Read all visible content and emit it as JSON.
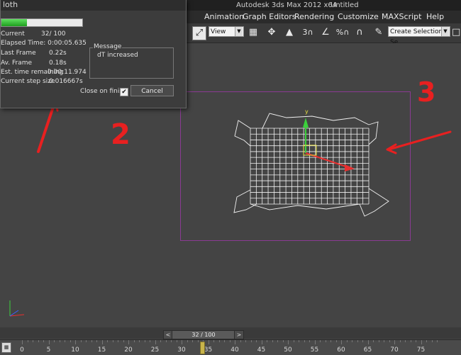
{
  "titlebar": {
    "app_title": "Autodesk 3ds Max  2012 x64",
    "doc_title": "Untitled"
  },
  "menu": [
    "Animation",
    "Graph Editors",
    "Rendering",
    "Customize",
    "MAXScript",
    "Help"
  ],
  "toolbar": {
    "view_combo": "View",
    "selection_set_combo": "Create Selection Se",
    "snap_label": "3",
    "percent_snap_label": "%"
  },
  "dialog": {
    "title": "loth",
    "progress_fraction": 0.32,
    "rows": [
      {
        "label": "Current",
        "value": "32/  100"
      },
      {
        "label": "Elapsed Time: 0:00:05.635",
        "value": ""
      },
      {
        "label": "Last Frame",
        "value": "0.22s"
      },
      {
        "label": "Av. Frame",
        "value": "0.18s"
      },
      {
        "label": "Est. time remaining",
        "value": "0:00:11.974"
      },
      {
        "label": "Current step size",
        "value": "0.016667s"
      }
    ],
    "message_label": "Message",
    "message_text": "dT increased",
    "close_on_finish_label": "Close on finish",
    "close_on_finish_checked": true,
    "cancel_label": "Cancel"
  },
  "viewport": {
    "gizmo_y_label": "y",
    "annotations": [
      "1",
      "2",
      "3"
    ]
  },
  "timeline": {
    "slider_label": "32 / 100",
    "prev_glyph": "<",
    "next_glyph": ">",
    "ticks": [
      "0",
      "5",
      "10",
      "15",
      "20",
      "25",
      "30",
      "35",
      "40",
      "45",
      "50",
      "55",
      "60",
      "65",
      "70",
      "75"
    ]
  },
  "colors": {
    "viewport_bg": "#444444",
    "safe_frame": "#8a3a93",
    "annotation_red": "#e82020",
    "progress_green": "#2fb52f"
  }
}
